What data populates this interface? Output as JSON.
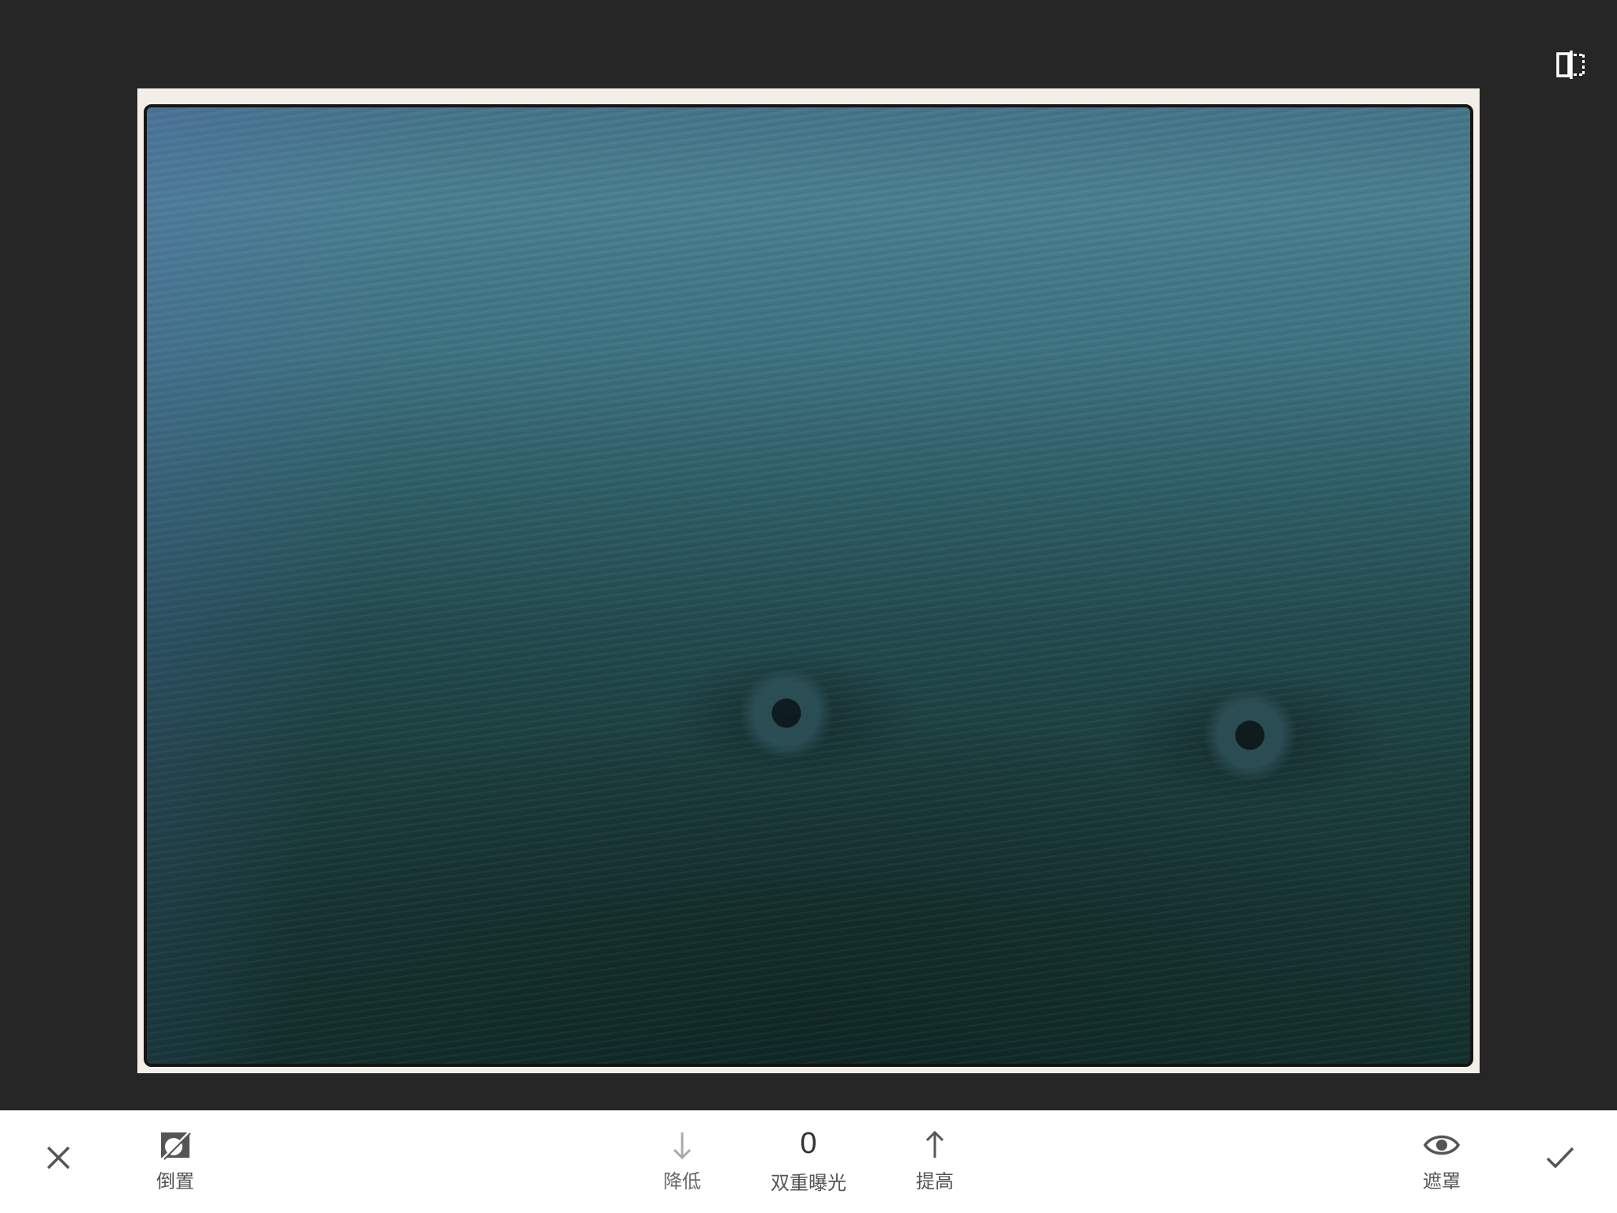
{
  "toolbar": {
    "invert_label": "倒置",
    "decrease_label": "降低",
    "value": "0",
    "tool_label": "双重曝光",
    "increase_label": "提高",
    "mask_label": "遮罩"
  },
  "icons": {
    "compare": "compare-icon",
    "cancel": "close-icon",
    "invert": "invert-icon",
    "decrease": "arrow-down-icon",
    "increase": "arrow-up-icon",
    "mask": "eye-icon",
    "apply": "checkmark-icon"
  },
  "colors": {
    "background": "#262626",
    "toolbar": "#ffffff",
    "icon": "#555555",
    "icon_disabled": "#aaaaaa"
  }
}
